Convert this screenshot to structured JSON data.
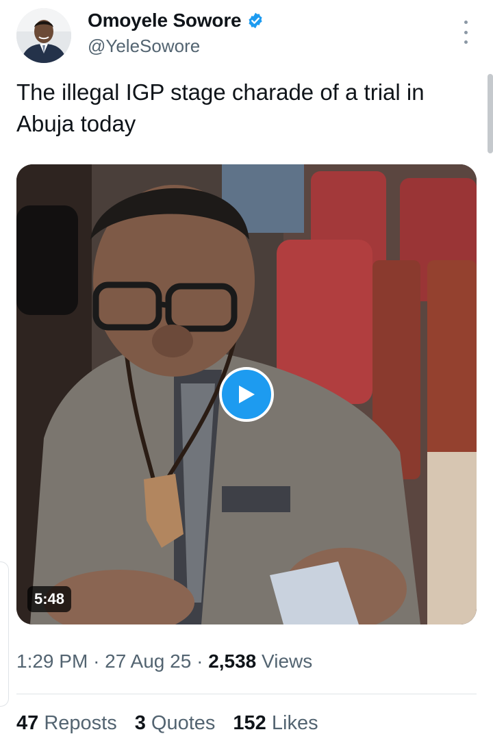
{
  "author": {
    "name": "Omoyele Sowore",
    "handle": "@YeleSowore",
    "verified": true,
    "avatar_icon": "profile-photo"
  },
  "tweet": {
    "text": "The illegal IGP stage charade of a trial in Abuja today"
  },
  "media": {
    "type": "video",
    "duration": "5:48",
    "play_icon": "play-icon"
  },
  "meta": {
    "time": "1:29 PM",
    "separator": "·",
    "date": "27 Aug 25",
    "views_count": "2,538",
    "views_label": "Views"
  },
  "stats": [
    {
      "count": "47",
      "label": "Reposts"
    },
    {
      "count": "3",
      "label": "Quotes"
    },
    {
      "count": "152",
      "label": "Likes"
    }
  ],
  "colors": {
    "accent": "#1d9bf0",
    "text_primary": "#0f1419",
    "text_secondary": "#536471"
  }
}
